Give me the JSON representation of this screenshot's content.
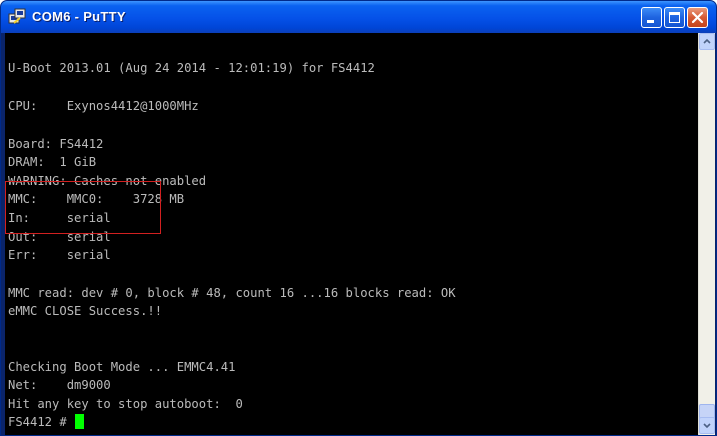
{
  "window": {
    "title": "COM6 - PuTTY",
    "icon": "putty-icon"
  },
  "terminal": {
    "lines": [
      "U-Boot 2013.01 (Aug 24 2014 - 12:01:19) for FS4412",
      "CPU:    Exynos4412@1000MHz",
      "Board: FS4412",
      "DRAM:  1 GiB",
      "WARNING: Caches not enabled",
      "MMC:    MMC0:    3728 MB",
      "In:     serial",
      "Out:    serial",
      "Err:    serial",
      "MMC read: dev # 0, block # 48, count 16 ...16 blocks read: OK",
      "eMMC CLOSE Success.!!",
      "Checking Boot Mode ... EMMC4.41",
      "Net:    dm9000",
      "Hit any key to stop autoboot:  0",
      "FS4412 # "
    ]
  },
  "colors": {
    "titlebar": "#0551e8",
    "terminal_bg": "#000000",
    "terminal_fg": "#bbbbbb",
    "cursor": "#00ff00",
    "highlight_box": "#d22020"
  }
}
